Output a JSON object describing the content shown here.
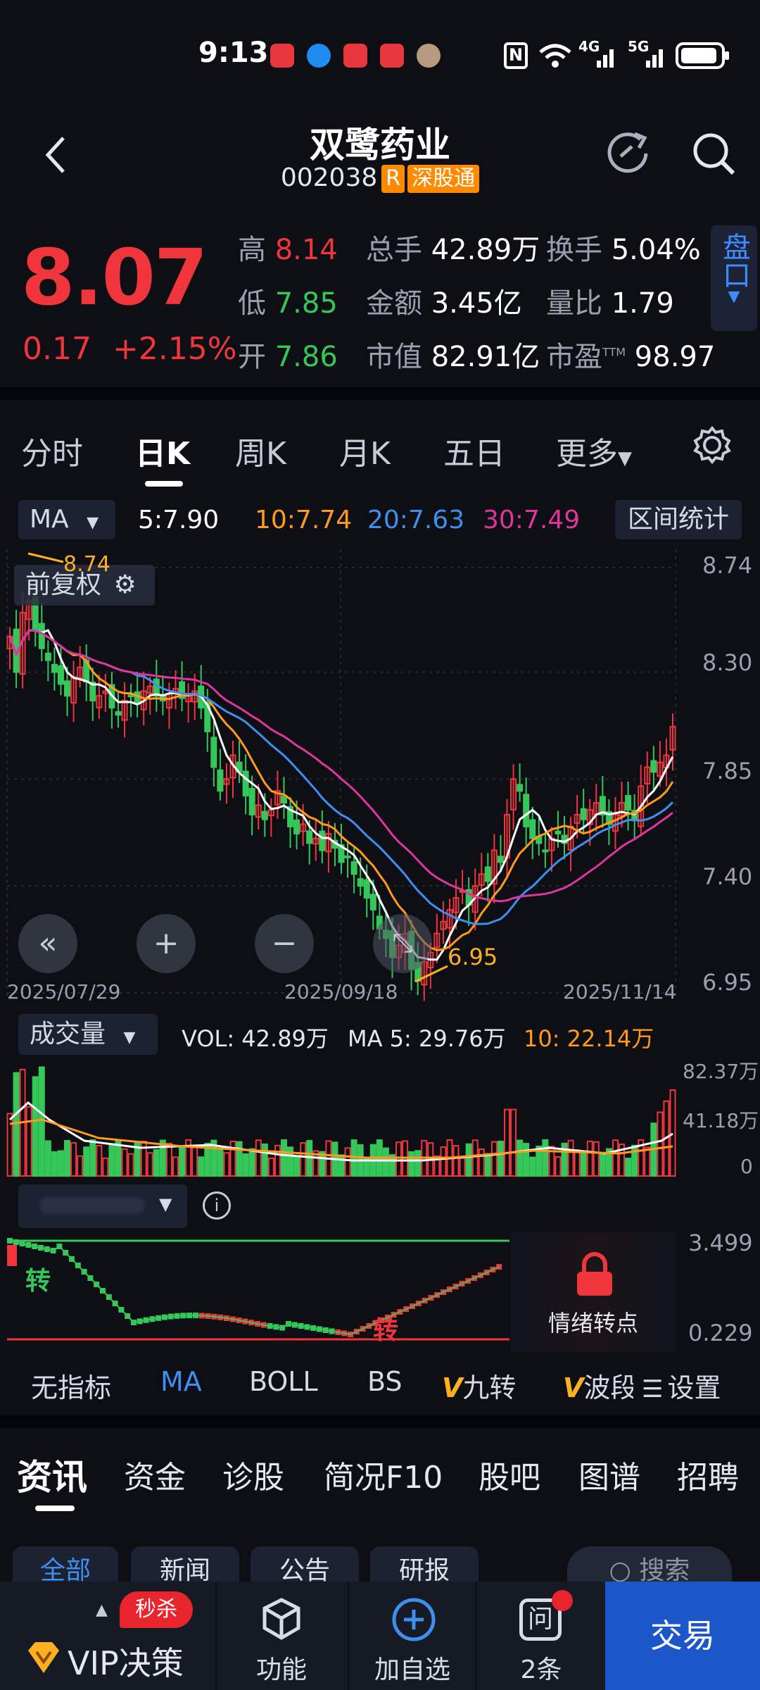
{
  "status_bar": {
    "time": "9:13",
    "network_1": "4G",
    "network_2": "5G"
  },
  "header": {
    "name": "双鹭药业",
    "code": "002038",
    "tag_r": "R",
    "tag_connect": "深股通"
  },
  "quote": {
    "price": "8.07",
    "change": "0.17",
    "change_pct": "+2.15%",
    "high_label": "高",
    "high": "8.14",
    "low_label": "低",
    "low": "7.85",
    "open_label": "开",
    "open": "7.86",
    "vol_label": "总手",
    "vol": "42.89万",
    "amount_label": "金额",
    "amount": "3.45亿",
    "mcap_label": "市值",
    "mcap": "82.91亿",
    "turnover_label": "换手",
    "turnover": "5.04%",
    "ratio_label": "量比",
    "ratio": "1.79",
    "pe_label": "市盈",
    "pe_sup": "TTM",
    "pe": "98.97",
    "pankou": "盘口"
  },
  "period_tabs": [
    "分时",
    "日K",
    "周K",
    "月K",
    "五日",
    "更多"
  ],
  "ma_row": {
    "selector": "MA",
    "ma5": "5:7.90",
    "ma10": "10:7.74",
    "ma20": "20:7.63",
    "ma30": "30:7.49",
    "stats_button": "区间统计"
  },
  "kchart": {
    "fuquan": "前复权",
    "y_ticks": [
      "8.74",
      "8.30",
      "7.85",
      "7.40",
      "6.95"
    ],
    "dates": [
      "2025/07/29",
      "2025/09/18",
      "2025/11/14"
    ],
    "high_mark": "8.74",
    "low_mark": "6.95"
  },
  "volume": {
    "selector": "成交量",
    "vol": "VOL: 42.89万",
    "ma5": "MA 5: 29.76万",
    "ma10": "10: 22.14万",
    "y_ticks": [
      "82.37万",
      "41.18万",
      "0"
    ]
  },
  "indicator": {
    "y_ticks": [
      "3.499",
      "0.229"
    ],
    "mark_1": "转",
    "mark_2": "转",
    "lock_label": "情绪转点"
  },
  "indicator_tabs": [
    "无指标",
    "MA",
    "BOLL",
    "BS",
    "九转",
    "波段",
    "设置"
  ],
  "news_tabs": [
    "资讯",
    "资金",
    "诊股",
    "简况F10",
    "股吧",
    "图谱",
    "招聘"
  ],
  "sub_chips": [
    "全部",
    "新闻",
    "公告",
    "研报"
  ],
  "search_placeholder": "搜索",
  "bottom_nav": {
    "vip_badge": "秒杀",
    "vip": "VIP决策",
    "func": "功能",
    "add": "加自选",
    "ask": "2条",
    "trade": "交易"
  },
  "colors": {
    "up": "#f0353d",
    "down": "#35c759",
    "ma5": "#ffffff",
    "ma10": "#ff9a1f",
    "ma20": "#3f8ff0",
    "ma30": "#e0359c",
    "trade_button": "#1b57c9"
  }
}
